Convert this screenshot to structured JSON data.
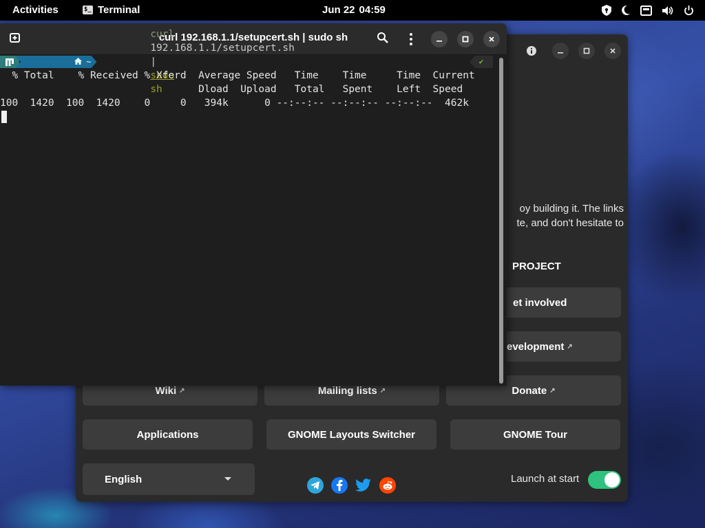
{
  "topbar": {
    "activities": "Activities",
    "app_name": "Terminal",
    "date": "Jun 22",
    "time": "04:59"
  },
  "terminal": {
    "title": "curl 192.168.1.1/setupcert.sh | sudo sh",
    "prompt_dir": "~",
    "command": {
      "cmd": "curl",
      "arg": "192.168.1.1/setupcert.sh",
      "pipe": "|",
      "sudo": "sudo",
      "sh": "sh"
    },
    "status_mark": "✔",
    "output": [
      "  % Total    % Received % Xferd  Average Speed   Time    Time     Time  Current",
      "                                 Dload  Upload   Total   Spent    Left  Speed",
      "100  1420  100  1420    0     0   394k      0 --:--:-- --:--:-- --:--:--  462k"
    ]
  },
  "welcome": {
    "text_lines": [
      "oy building it. The links",
      "te, and don't hesitate to"
    ],
    "project_heading": "PROJECT",
    "buttons": {
      "get_involved": "et involved",
      "development": "evelopment",
      "wiki": "Wiki",
      "mailing_lists": "Mailing lists",
      "donate": "Donate",
      "applications": "Applications",
      "layouts_switcher": "GNOME Layouts Switcher",
      "tour": "GNOME Tour"
    },
    "language": "English",
    "launch_at_start_label": "Launch at start",
    "launch_at_start": true,
    "social_icons": [
      "telegram-icon",
      "facebook-icon",
      "twitter-icon",
      "reddit-icon"
    ]
  }
}
